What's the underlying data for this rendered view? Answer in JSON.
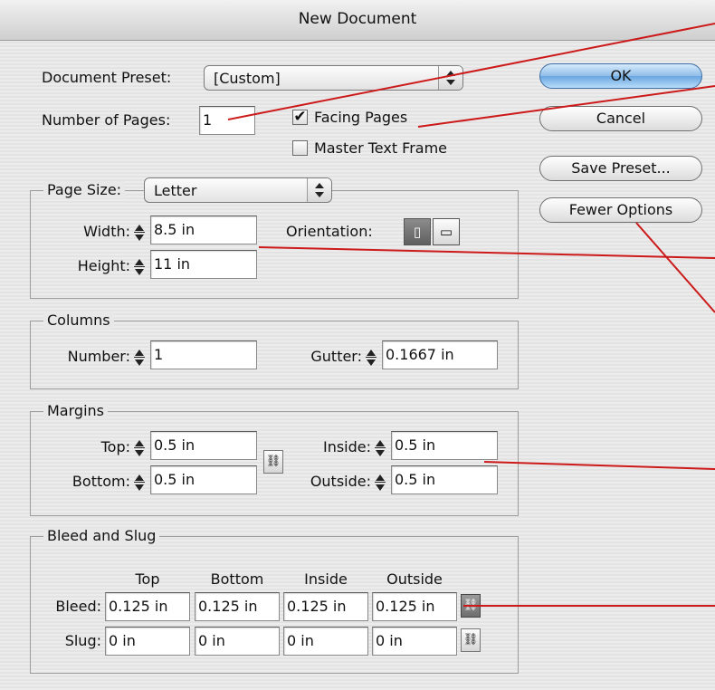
{
  "dialog": {
    "title": "New Document"
  },
  "preset": {
    "label": "Document Preset:",
    "value": "[Custom]"
  },
  "pages": {
    "label": "Number of Pages:",
    "value": "1"
  },
  "facing_pages": {
    "label": "Facing Pages",
    "checked": true
  },
  "master_text_frame": {
    "label": "Master Text Frame",
    "checked": false
  },
  "buttons": {
    "ok": "OK",
    "cancel": "Cancel",
    "save_preset": "Save Preset...",
    "fewer_options": "Fewer Options"
  },
  "page_size": {
    "label": "Page Size:",
    "value": "Letter",
    "width_label": "Width:",
    "width": "8.5 in",
    "height_label": "Height:",
    "height": "11 in",
    "orientation_label": "Orientation:",
    "orientation_selected": "portrait"
  },
  "columns": {
    "title": "Columns",
    "number_label": "Number:",
    "number": "1",
    "gutter_label": "Gutter:",
    "gutter": "0.1667 in"
  },
  "margins": {
    "title": "Margins",
    "top_label": "Top:",
    "top": "0.5 in",
    "bottom_label": "Bottom:",
    "bottom": "0.5 in",
    "inside_label": "Inside:",
    "inside": "0.5 in",
    "outside_label": "Outside:",
    "outside": "0.5 in"
  },
  "bleed_slug": {
    "title": "Bleed and Slug",
    "col_top": "Top",
    "col_bottom": "Bottom",
    "col_inside": "Inside",
    "col_outside": "Outside",
    "bleed_label": "Bleed:",
    "bleed_top": "0.125 in",
    "bleed_bottom": "0.125 in",
    "bleed_inside": "0.125 in",
    "bleed_outside": "0.125 in",
    "slug_label": "Slug:",
    "slug_top": "0 in",
    "slug_bottom": "0 in",
    "slug_inside": "0 in",
    "slug_outside": "0 in"
  },
  "annotation_color": "#cc1a1a",
  "default_button_color": "#6aa7e0"
}
